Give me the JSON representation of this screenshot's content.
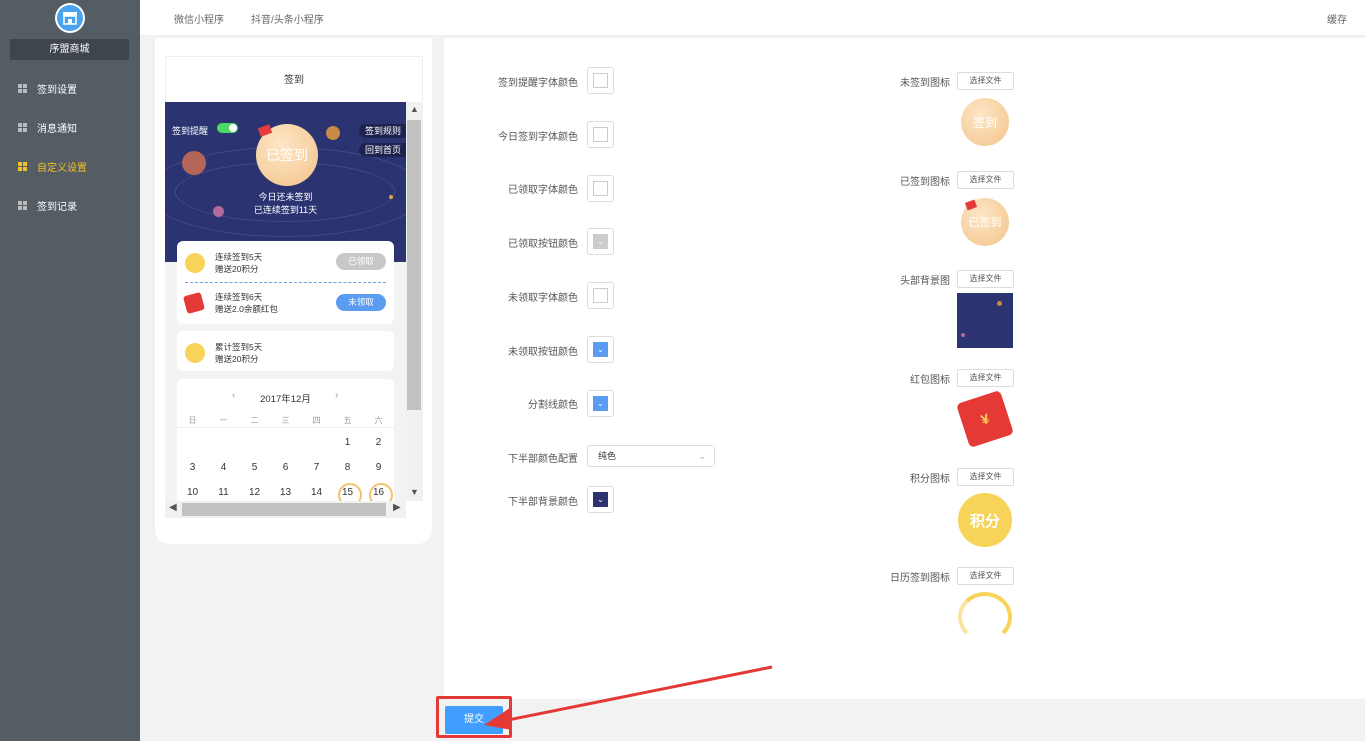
{
  "sidebar": {
    "store_name": "序盟商城",
    "items": [
      {
        "label": "签到设置"
      },
      {
        "label": "消息通知"
      },
      {
        "label": "自定义设置"
      },
      {
        "label": "签到记录"
      }
    ]
  },
  "topbar": {
    "tabs": [
      {
        "label": "微信小程序"
      },
      {
        "label": "抖音/头条小程序"
      }
    ],
    "cache_label": "缓存"
  },
  "preview": {
    "title": "签到",
    "remind_label": "签到提醒",
    "rule_label": "签到规则",
    "home_label": "回到首页",
    "signed_badge": "已签到",
    "today_status": "今日还未签到",
    "streak_text": "已连续签到11天",
    "rewards": [
      {
        "line1": "连续签到5天",
        "line2": "赠送20积分",
        "button": "已领取"
      },
      {
        "line1": "连续签到6天",
        "line2": "赠送2.0余额红包",
        "button": "未领取"
      }
    ],
    "cumulative": {
      "line1": "累计签到5天",
      "line2": "赠送20积分"
    },
    "calendar": {
      "month": "2017年12月",
      "weekdays": [
        "日",
        "一",
        "二",
        "三",
        "四",
        "五",
        "六"
      ],
      "row1": [
        "",
        "",
        "",
        "",
        "",
        "1",
        "2"
      ],
      "row2": [
        "3",
        "4",
        "5",
        "6",
        "7",
        "8",
        "9"
      ],
      "row3": [
        "10",
        "11",
        "12",
        "13",
        "14",
        "15",
        "16"
      ]
    }
  },
  "form": {
    "fields": [
      {
        "label": "签到提醒字体颜色",
        "color": "#ffffff"
      },
      {
        "label": "今日签到字体颜色",
        "color": "#ffffff"
      },
      {
        "label": "已领取字体颜色",
        "color": "#ffffff"
      },
      {
        "label": "已领取按钮颜色",
        "color": "#cccccc"
      },
      {
        "label": "未领取字体颜色",
        "color": "#ffffff"
      },
      {
        "label": "未领取按钮颜色",
        "color": "#5b9cf2"
      },
      {
        "label": "分割线颜色",
        "color": "#5b9cf2"
      },
      {
        "label": "下半部颜色配置",
        "select_value": "纯色"
      },
      {
        "label": "下半部背景颜色",
        "color": "#2b3370"
      }
    ],
    "images": [
      {
        "label": "未签到图标",
        "button": "选择文件",
        "icon_text": "签到"
      },
      {
        "label": "已签到图标",
        "button": "选择文件",
        "icon_text": "已签到"
      },
      {
        "label": "头部背景图",
        "button": "选择文件"
      },
      {
        "label": "红包图标",
        "button": "选择文件",
        "icon_text": "¥"
      },
      {
        "label": "积分图标",
        "button": "选择文件",
        "icon_text": "积分"
      },
      {
        "label": "日历签到图标",
        "button": "选择文件"
      }
    ]
  },
  "submit_label": "提交",
  "colors": {
    "accent": "#409eff",
    "sidebar": "#545c64",
    "active": "#f5c123",
    "highlight": "#e53935"
  }
}
